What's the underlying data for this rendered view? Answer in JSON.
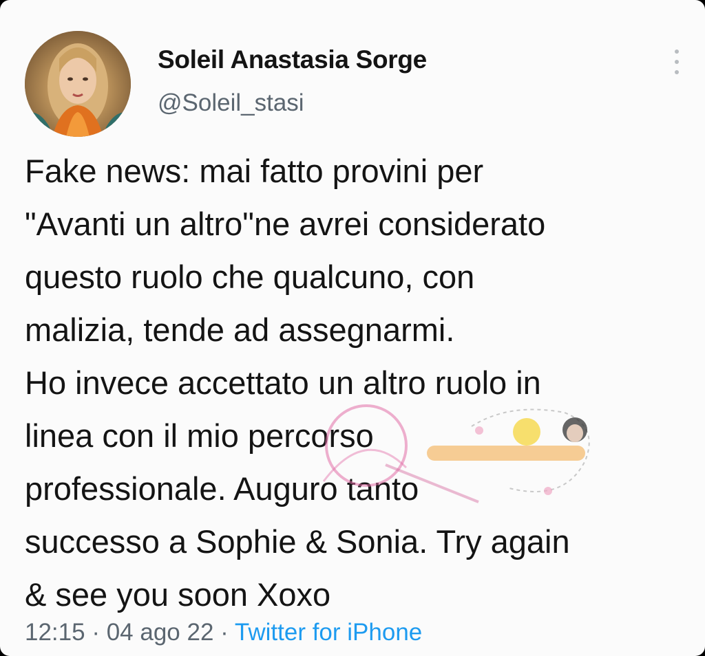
{
  "tweet": {
    "author_name": "Soleil Anastasia Sorge",
    "author_handle": "@Soleil_stasi",
    "body_lines": [
      "Fake news: mai fatto provini per",
      "\"Avanti un altro\"ne avrei considerato",
      "questo ruolo che qualcuno, con",
      "malizia, tende ad assegnarmi.",
      "Ho invece accettato un altro ruolo in",
      "linea con il mio percorso",
      "professionale. Auguro tanto",
      "successo a Sophie & Sonia. Try again",
      "& see you soon Xoxo"
    ],
    "time": "12:15",
    "separator": " · ",
    "date": "04 ago 22",
    "source": "Twitter for iPhone"
  },
  "icons": {
    "avatar": "profile-photo",
    "more": "more-vertical-icon"
  },
  "colors": {
    "background": "#fbfbfb",
    "text": "#141414",
    "secondary_text": "#5b6670",
    "link": "#1d9bf0"
  }
}
